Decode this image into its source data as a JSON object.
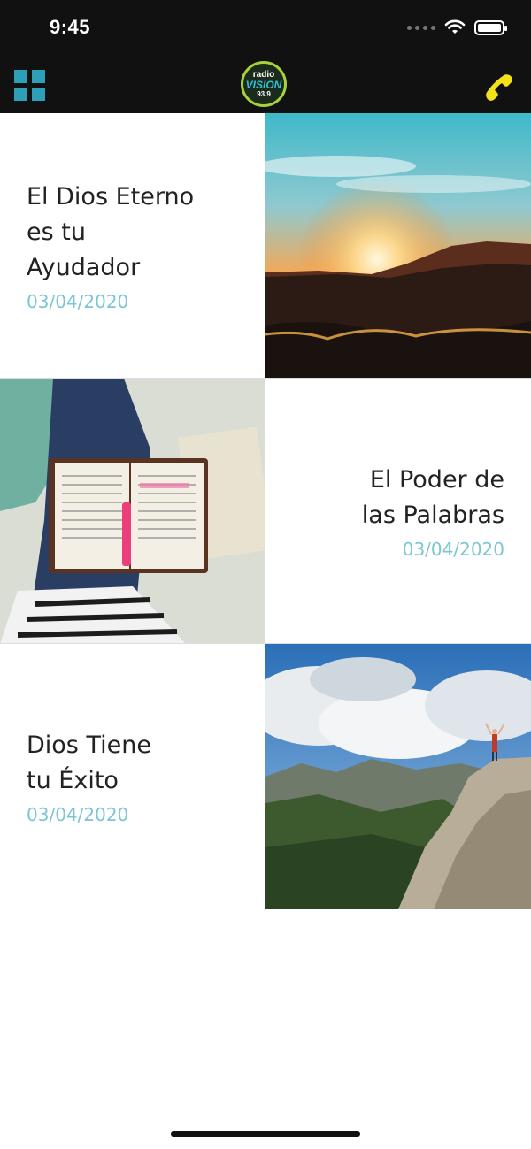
{
  "status_bar": {
    "time": "9:45"
  },
  "nav": {
    "menu_icon": "grid-icon",
    "logo": {
      "top": "radio",
      "middle": "VISION",
      "number": "93.9"
    },
    "call_icon": "phone-icon"
  },
  "posts": [
    {
      "title_lines": [
        "El Dios Eterno",
        "es tu",
        "Ayudador"
      ],
      "date": "03/04/2020",
      "image": "sunset-mountain"
    },
    {
      "title_lines": [
        "El Poder de",
        "las Palabras"
      ],
      "date": "03/04/2020",
      "image": "open-bible"
    },
    {
      "title_lines": [
        "Dios Tiene",
        "tu Éxito"
      ],
      "date": "03/04/2020",
      "image": "mountain-summit"
    }
  ],
  "colors": {
    "bar": "#111111",
    "accent_grid": "#2e9fb8",
    "phone": "#f5e11a",
    "date": "#7cc6d3",
    "title": "#222222"
  }
}
